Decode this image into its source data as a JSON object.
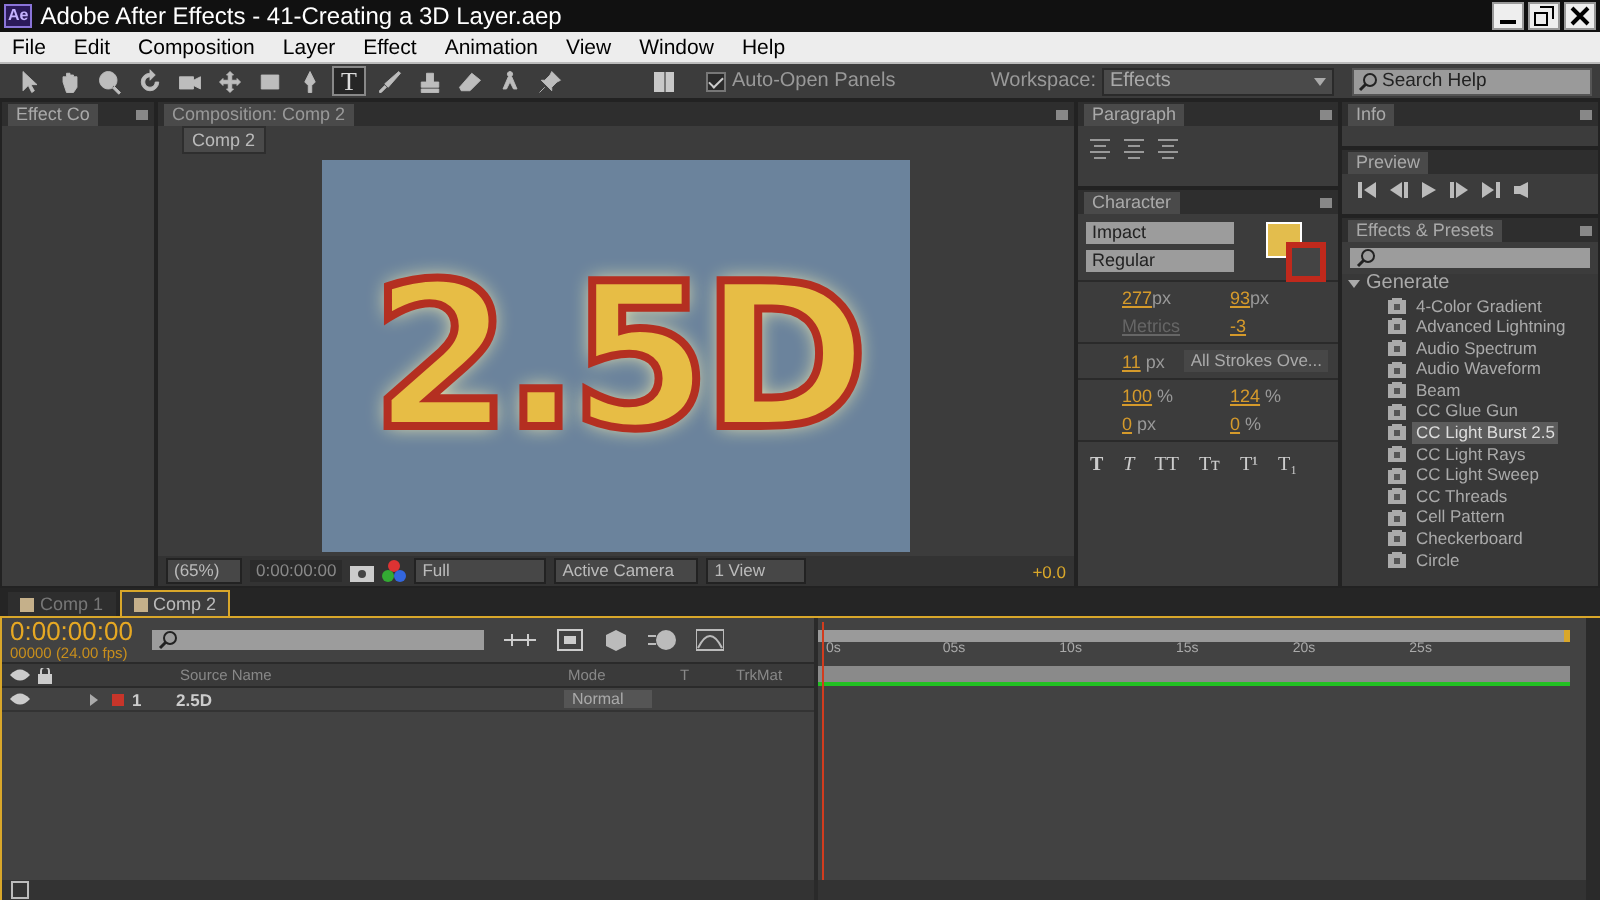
{
  "window": {
    "app_badge": "Ae",
    "title": "Adobe After Effects - 41-Creating a 3D Layer.aep"
  },
  "menu": [
    "File",
    "Edit",
    "Composition",
    "Layer",
    "Effect",
    "Animation",
    "View",
    "Window",
    "Help"
  ],
  "toolbar": {
    "tools": [
      {
        "kind": "arrow",
        "selected": false
      },
      {
        "kind": "hand",
        "selected": false
      },
      {
        "kind": "zoom",
        "selected": false
      },
      {
        "kind": "rotate",
        "selected": false
      },
      {
        "kind": "camera",
        "selected": false
      },
      {
        "kind": "pan",
        "selected": false
      },
      {
        "kind": "rect",
        "selected": false
      },
      {
        "kind": "pen",
        "selected": false
      },
      {
        "kind": "type",
        "label": "T",
        "selected": true
      },
      {
        "kind": "brush",
        "selected": false
      },
      {
        "kind": "stamp",
        "selected": false
      },
      {
        "kind": "eraser",
        "selected": false
      },
      {
        "kind": "puppet",
        "selected": false
      },
      {
        "kind": "pin",
        "selected": false
      }
    ],
    "auto_open": {
      "label": "Auto-Open Panels",
      "checked": true
    },
    "workspace": {
      "label": "Workspace:",
      "value": "Effects"
    },
    "search": {
      "placeholder": "Search Help"
    }
  },
  "effect_controls": {
    "tab": "Effect Co"
  },
  "composition": {
    "tab": "Composition: Comp 2",
    "breadcrumb": "Comp 2",
    "content_text": "2.5D",
    "zoom": "(65%)",
    "timecode": "0:00:00:00",
    "resolution": "Full",
    "camera": "Active Camera",
    "views": "1 View",
    "exposure": "+0.0"
  },
  "paragraph": {
    "tab": "Paragraph"
  },
  "character": {
    "tab": "Character",
    "font": "Impact",
    "style": "Regular",
    "fields": [
      {
        "value": "277",
        "unit": "px",
        "disabled": false
      },
      {
        "value": "93",
        "unit": "px",
        "disabled": false
      },
      {
        "value": "Metrics",
        "disabled": true
      },
      {
        "value": "-3",
        "disabled": false
      }
    ],
    "stroke": {
      "value": "11",
      "unit": "px",
      "mode": "All Strokes Ove..."
    },
    "scale_fields": [
      {
        "value": "100",
        "unit": "%"
      },
      {
        "value": "124",
        "unit": "%"
      },
      {
        "value": "0",
        "unit": "px"
      },
      {
        "value": "0",
        "unit": "%"
      }
    ],
    "format_buttons": [
      "T",
      "T",
      "TT",
      "Tт",
      "T¹",
      "T₁"
    ]
  },
  "info": {
    "tab": "Info"
  },
  "preview": {
    "tab": "Preview"
  },
  "effects_presets": {
    "tab": "Effects & Presets",
    "category": "Generate",
    "expanded": true,
    "items": [
      {
        "label": "4-Color Gradient",
        "selected": false
      },
      {
        "label": "Advanced Lightning",
        "selected": false
      },
      {
        "label": "Audio Spectrum",
        "selected": false
      },
      {
        "label": "Audio Waveform",
        "selected": false
      },
      {
        "label": "Beam",
        "selected": false
      },
      {
        "label": "CC Glue Gun",
        "selected": false
      },
      {
        "label": "CC Light Burst 2.5",
        "selected": true
      },
      {
        "label": "CC Light Rays",
        "selected": false
      },
      {
        "label": "CC Light Sweep",
        "selected": false
      },
      {
        "label": "CC Threads",
        "selected": false
      },
      {
        "label": "Cell Pattern",
        "selected": false
      },
      {
        "label": "Checkerboard",
        "selected": false
      },
      {
        "label": "Circle",
        "selected": false
      }
    ]
  },
  "timeline": {
    "tabs": [
      {
        "label": "Comp 1",
        "selected": false
      },
      {
        "label": "Comp 2",
        "selected": true
      }
    ],
    "timecode": "0:00:00:00",
    "fps": "00000 (24.00 fps)",
    "columns": {
      "name": "Source Name",
      "mode": "Mode",
      "t": "T",
      "trkmat": "TrkMat"
    },
    "layers": [
      {
        "number": "1",
        "name": "2.5D",
        "mode": "Normal",
        "color": "#c8352a",
        "visible": true
      }
    ],
    "ruler": [
      "0s",
      "05s",
      "10s",
      "15s",
      "20s",
      "25s"
    ]
  }
}
